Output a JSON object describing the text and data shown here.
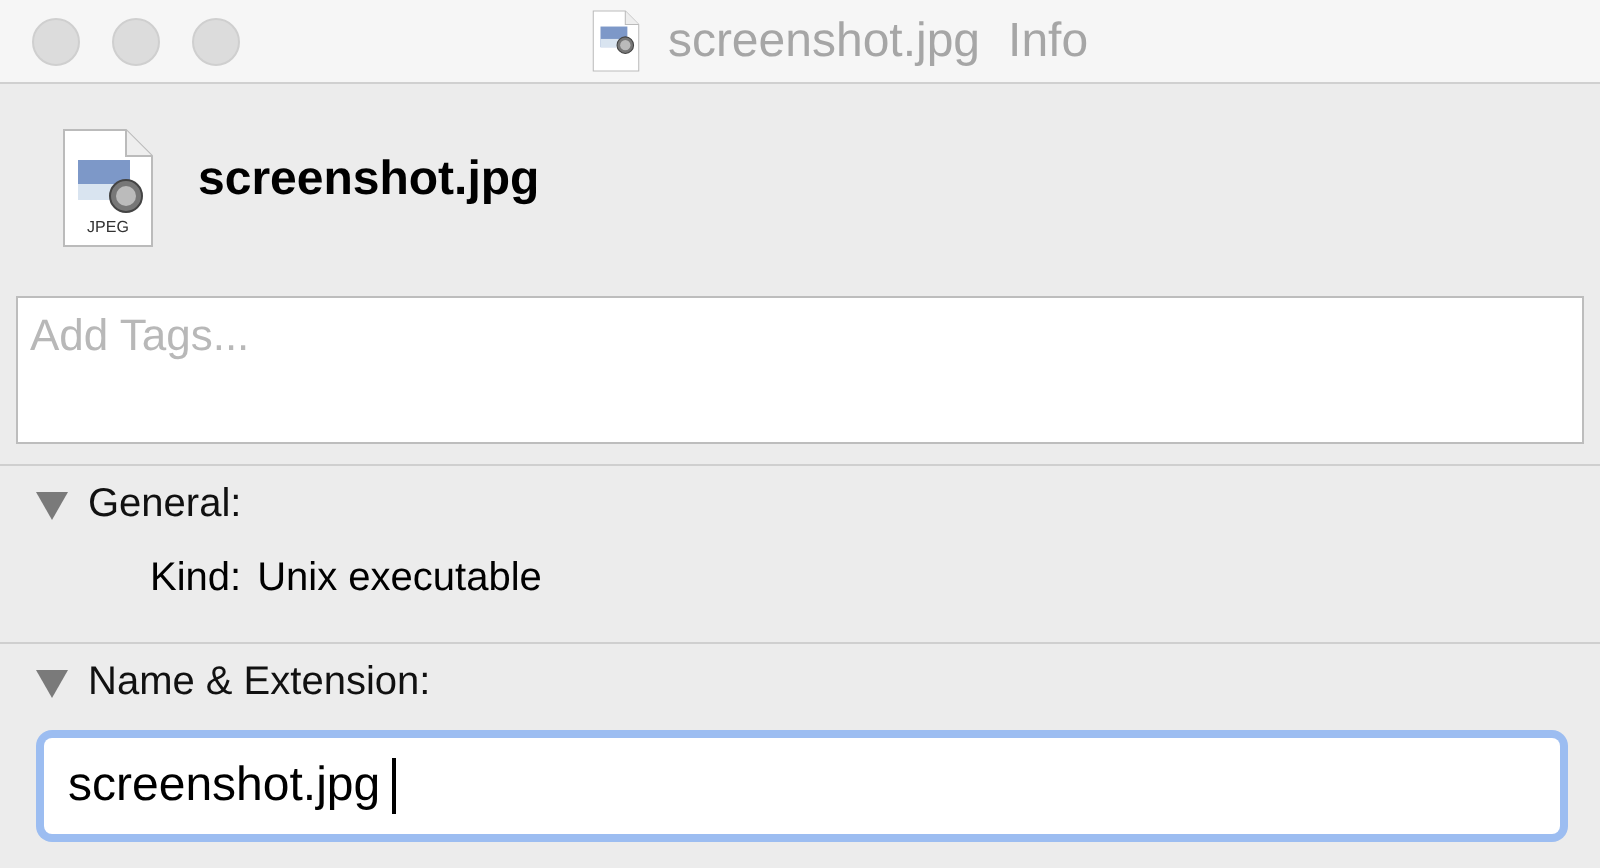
{
  "window": {
    "title": "screenshot.jpg",
    "subtitle": "Info"
  },
  "header": {
    "icon_label": "JPEG",
    "file_name": "screenshot.jpg"
  },
  "tags_field": {
    "placeholder": "Add Tags..."
  },
  "sections": [
    {
      "kind": "info",
      "title": "General:",
      "expanded": true,
      "rows": [
        {
          "label": "Kind:",
          "value": "Unix executable"
        }
      ]
    },
    {
      "kind": "field",
      "title": "Name & Extension:",
      "expanded": true,
      "value": "screenshot.jpg",
      "focused": true
    }
  ]
}
